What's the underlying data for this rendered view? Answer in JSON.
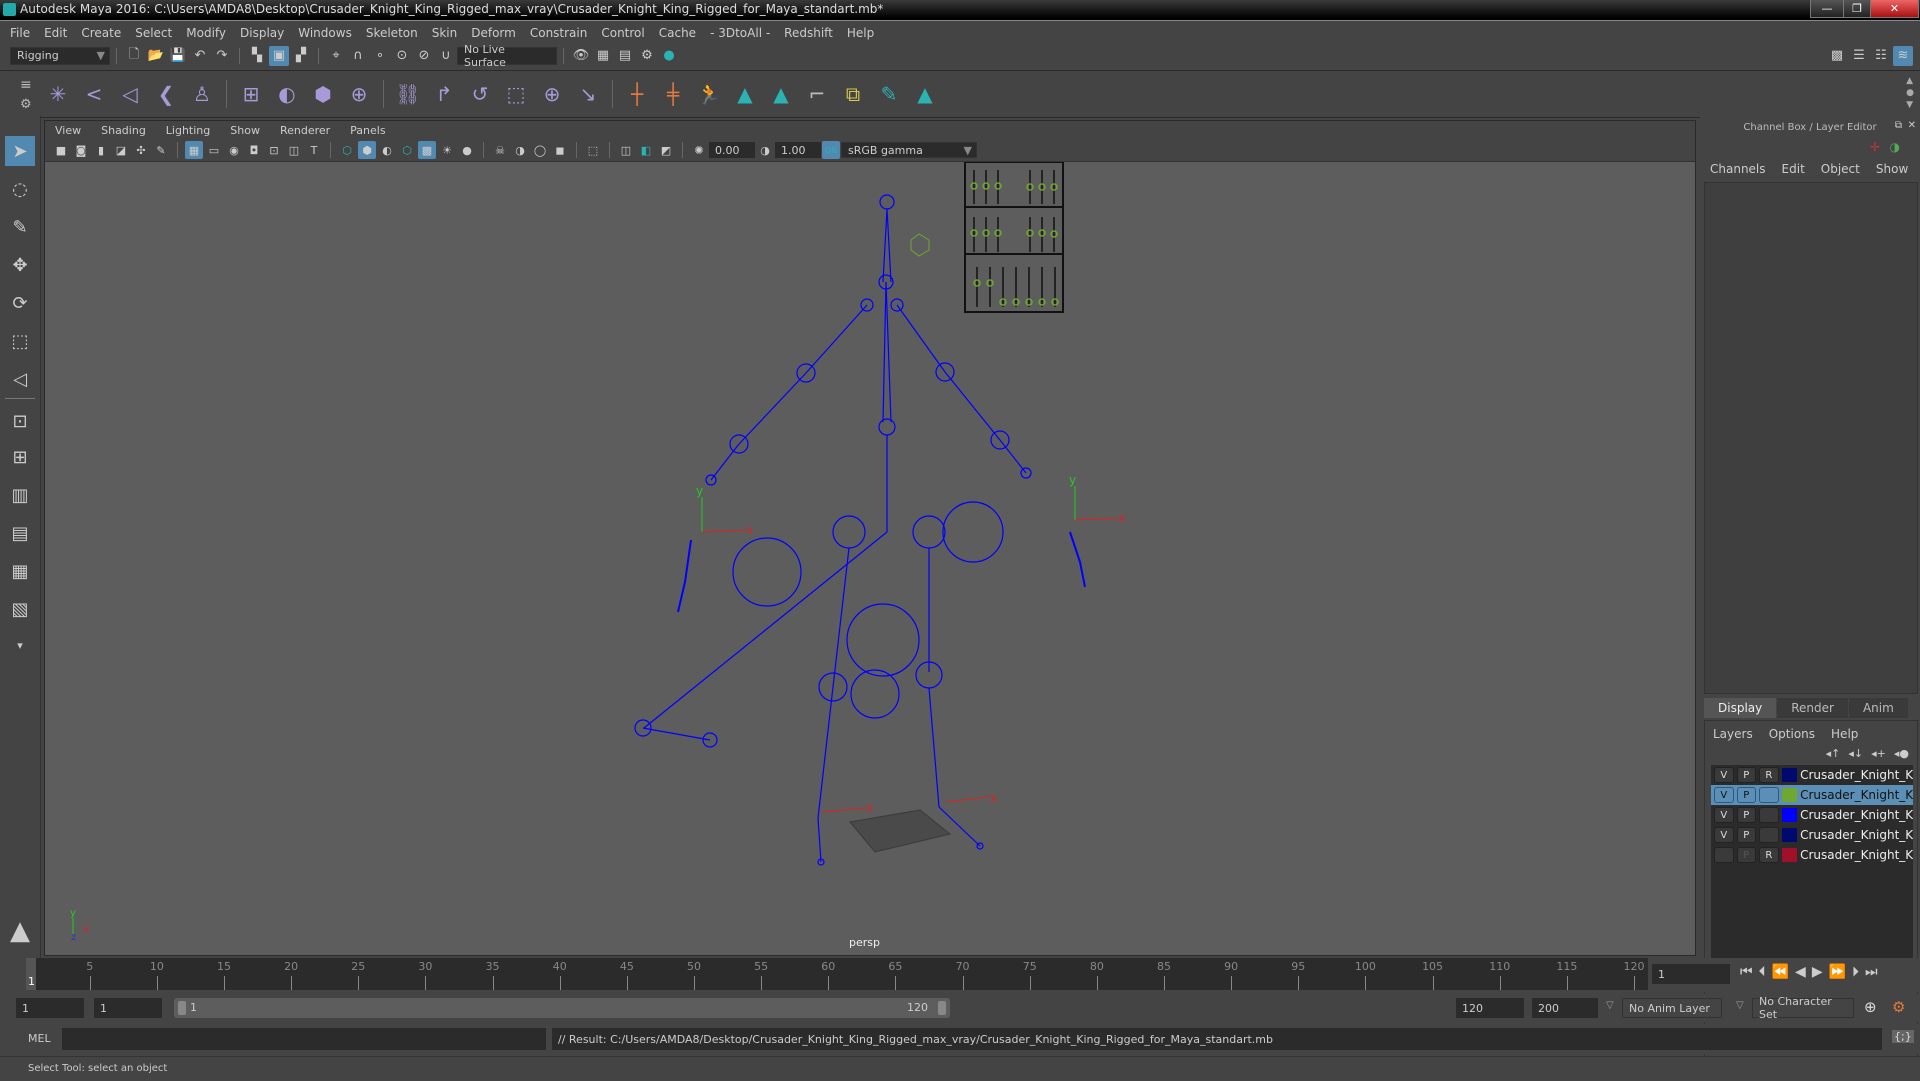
{
  "window": {
    "title": "Autodesk Maya 2016: C:\\Users\\AMDA8\\Desktop\\Crusader_Knight_King_Rigged_max_vray\\Crusader_Knight_King_Rigged_for_Maya_standart.mb*",
    "minimize": "—",
    "restore": "❐",
    "close": "✕"
  },
  "menubar": [
    "File",
    "Edit",
    "Create",
    "Select",
    "Modify",
    "Display",
    "Windows",
    "Skeleton",
    "Skin",
    "Deform",
    "Constrain",
    "Control",
    "Cache",
    "- 3DtoAll -",
    "Redshift",
    "Help"
  ],
  "statusline": {
    "menuset": "Rigging",
    "live_surface": "No Live Surface"
  },
  "viewport": {
    "menu": [
      "View",
      "Shading",
      "Lighting",
      "Show",
      "Renderer",
      "Panels"
    ],
    "exposure": "0.00",
    "gamma": "1.00",
    "color_mgmt_toggle": "ON",
    "color_space": "sRGB gamma",
    "camera_label": "persp",
    "axis_labels": {
      "x": "x",
      "y": "y",
      "z": "z"
    }
  },
  "channel_box": {
    "title": "Channel Box / Layer Editor",
    "menu": [
      "Channels",
      "Edit",
      "Object",
      "Show"
    ]
  },
  "layer_editor": {
    "tabs": [
      "Display",
      "Render",
      "Anim"
    ],
    "active_tab": "Display",
    "menu": [
      "Layers",
      "Options",
      "Help"
    ],
    "layers": [
      {
        "v": "V",
        "p": "P",
        "r": "R",
        "color": "#000a6e",
        "name": "Crusader_Knight_King_",
        "selected": false
      },
      {
        "v": "V",
        "p": "P",
        "r": "",
        "color": "#6ea832",
        "name": "Crusader_Knight_King_",
        "selected": true
      },
      {
        "v": "V",
        "p": "P",
        "r": "",
        "color": "#0000ff",
        "name": "Crusader_Knight_King_",
        "selected": false
      },
      {
        "v": "V",
        "p": "P",
        "r": "",
        "color": "#000a6e",
        "name": "Crusader_Knight_King_",
        "selected": false
      },
      {
        "v": "",
        "p": "P",
        "r": "R",
        "color": "#a0102a",
        "name": "Crusader_Knight_King_",
        "selected": false
      }
    ]
  },
  "timeslider": {
    "ticks": [
      5,
      10,
      15,
      20,
      25,
      30,
      35,
      40,
      45,
      50,
      55,
      60,
      65,
      70,
      75,
      80,
      85,
      90,
      95,
      100,
      105,
      110,
      115,
      120
    ],
    "range_min": 1,
    "range_max": 120,
    "current_frame": "1",
    "current_frame_field": "1"
  },
  "range": {
    "start_time": "1",
    "playback_start": "1",
    "slider_start": "1",
    "slider_end": "120",
    "playback_end": "120",
    "end_time": "200",
    "anim_layer": "No Anim Layer",
    "character_set": "No Character Set"
  },
  "command_line": {
    "language": "MEL",
    "input": "",
    "result": "// Result: C:/Users/AMDA8/Desktop/Crusader_Knight_King_Rigged_max_vray/Crusader_Knight_King_Rigged_for_Maya_standart.mb"
  },
  "help_line": "Select Tool: select an object",
  "colors": {
    "accent": "#5289b0",
    "joint": "#0000ff",
    "control": "#6ea832"
  }
}
